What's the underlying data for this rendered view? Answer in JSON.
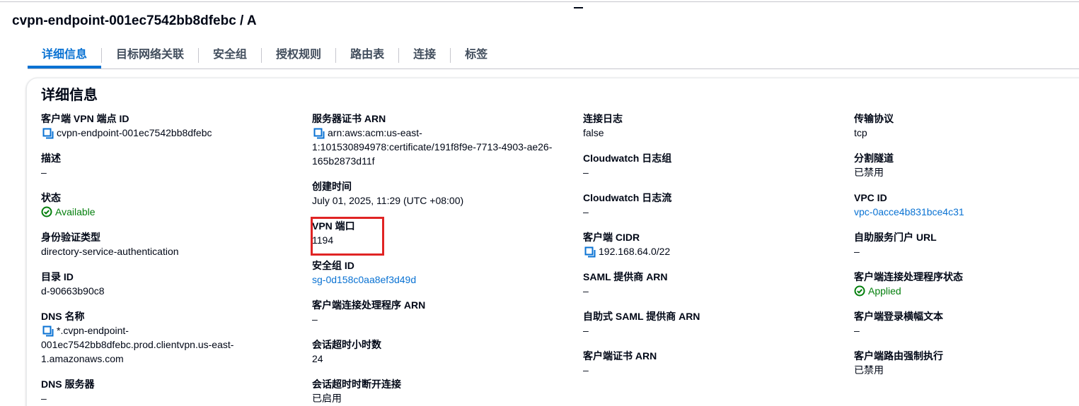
{
  "page": {
    "title": "cvpn-endpoint-001ec7542bb8dfebc / A"
  },
  "tabs": [
    {
      "label": "详细信息",
      "active": true
    },
    {
      "label": "目标网络关联",
      "active": false
    },
    {
      "label": "安全组",
      "active": false
    },
    {
      "label": "授权规则",
      "active": false
    },
    {
      "label": "路由表",
      "active": false
    },
    {
      "label": "连接",
      "active": false
    },
    {
      "label": "标签",
      "active": false
    }
  ],
  "details": {
    "header": "详细信息",
    "col1": {
      "endpoint_id": {
        "label": "客户端 VPN 端点 ID",
        "value": "cvpn-endpoint-001ec7542bb8dfebc",
        "icon": "copy-icon"
      },
      "description": {
        "label": "描述",
        "value": "–"
      },
      "state": {
        "label": "状态",
        "value": "Available",
        "icon": "check-circle-icon"
      },
      "auth_type": {
        "label": "身份验证类型",
        "value": "directory-service-authentication"
      },
      "directory_id": {
        "label": "目录 ID",
        "value": "d-90663b90c8"
      },
      "dns_name": {
        "label": "DNS 名称",
        "value_line1": "*.cvpn-endpoint-",
        "value_line2": "001ec7542bb8dfebc.prod.clientvpn.us-east-",
        "value_line3": "1.amazonaws.com",
        "icon": "copy-icon"
      },
      "dns_servers": {
        "label": "DNS 服务器",
        "value": "–"
      }
    },
    "col2": {
      "server_cert_arn": {
        "label": "服务器证书 ARN",
        "value_line1": "arn:aws:acm:us-east-",
        "value_line2": "1:101530894978:certificate/191f8f9e-7713-4903-ae26-",
        "value_line3": "165b2873d11f",
        "icon": "copy-icon"
      },
      "created_time": {
        "label": "创建时间",
        "value": "July 01, 2025, 11:29 (UTC +08:00)"
      },
      "vpn_port": {
        "label": "VPN 端口",
        "value": "1194"
      },
      "security_group_id": {
        "label": "安全组 ID",
        "value": "sg-0d158c0aa8ef3d49d"
      },
      "client_connect_handler_arn": {
        "label": "客户端连接处理程序 ARN",
        "value": "–"
      },
      "session_timeout_hours": {
        "label": "会话超时小时数",
        "value": "24"
      },
      "disconnect_on_session_timeout": {
        "label": "会话超时时断开连接",
        "value": "已启用"
      }
    },
    "col3": {
      "connection_log": {
        "label": "连接日志",
        "value": "false"
      },
      "cloudwatch_log_group": {
        "label": "Cloudwatch 日志组",
        "value": "–"
      },
      "cloudwatch_log_stream": {
        "label": "Cloudwatch 日志流",
        "value": "–"
      },
      "client_cidr": {
        "label": "客户端 CIDR",
        "value": "192.168.64.0/22",
        "icon": "copy-icon"
      },
      "saml_provider_arn": {
        "label": "SAML 提供商 ARN",
        "value": "–"
      },
      "self_service_saml_provider_arn": {
        "label": "自助式 SAML 提供商 ARN",
        "value": "–"
      },
      "client_cert_arn": {
        "label": "客户端证书 ARN",
        "value": "–"
      }
    },
    "col4": {
      "transport_protocol": {
        "label": "传输协议",
        "value": "tcp"
      },
      "split_tunnel": {
        "label": "分割隧道",
        "value": "已禁用"
      },
      "vpc_id": {
        "label": "VPC ID",
        "value": "vpc-0acce4b831bce4c31"
      },
      "self_service_portal_url": {
        "label": "自助服务门户 URL",
        "value": "–"
      },
      "client_connect_handler_status": {
        "label": "客户端连接处理程序状态",
        "value": "Applied",
        "icon": "check-circle-icon"
      },
      "client_login_banner_text": {
        "label": "客户端登录横幅文本",
        "value": "–"
      },
      "client_route_enforcement": {
        "label": "客户端路由强制执行",
        "value": "已禁用"
      }
    }
  },
  "colors": {
    "link": "#0972d3",
    "success": "#037f0c",
    "highlight": "#e02424",
    "text": "#000716"
  }
}
